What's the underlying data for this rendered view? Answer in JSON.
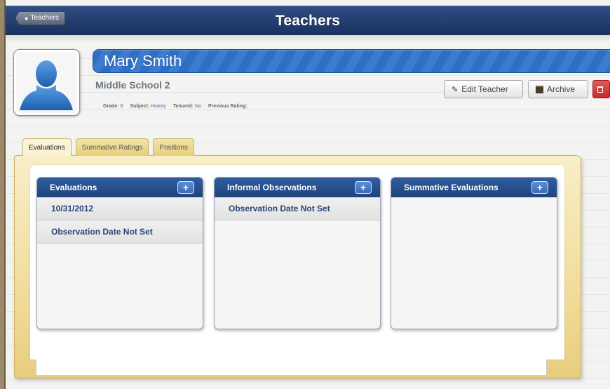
{
  "header": {
    "title": "Teachers",
    "back_label": "Teachers"
  },
  "teacher": {
    "name": "Mary Smith",
    "school": "Middle School 2",
    "grade_label": "Grade:",
    "grade": "8",
    "subject_label": "Subject:",
    "subject": "History",
    "tenured_label": "Tenured:",
    "tenured": "No",
    "previous_rating_label": "Previous Rating:",
    "previous_rating": ""
  },
  "actions": {
    "edit": "Edit Teacher",
    "archive": "Archive"
  },
  "tabs": [
    "Evaluations",
    "Summative Ratings",
    "Positions"
  ],
  "columns": [
    {
      "title": "Evaluations",
      "items": [
        "10/31/2012",
        "Observation Date Not Set"
      ]
    },
    {
      "title": "Informal Observations",
      "items": [
        "Observation Date Not Set"
      ]
    },
    {
      "title": "Summative Evaluations",
      "items": []
    }
  ],
  "icons": {
    "back": "user-icon",
    "edit": "pencil-icon",
    "archive": "archive-box-icon",
    "delete": "trash-icon",
    "add": "plus-icon",
    "avatar": "person-silhouette-icon"
  }
}
